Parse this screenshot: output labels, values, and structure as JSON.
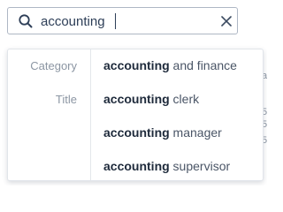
{
  "search": {
    "value": "accounting",
    "search_icon": "search-icon",
    "clear_icon": "close-icon"
  },
  "background": {
    "right_fragments": [
      "a",
      "5,",
      "5,",
      "5,"
    ]
  },
  "dropdown": {
    "groups": [
      {
        "label": "Category",
        "items": [
          {
            "match": "accounting",
            "rest": " and finance"
          }
        ]
      },
      {
        "label": "Title",
        "items": [
          {
            "match": "accounting",
            "rest": " clerk"
          },
          {
            "match": "accounting",
            "rest": " manager"
          },
          {
            "match": "accounting",
            "rest": " supervisor"
          }
        ]
      }
    ]
  },
  "colors": {
    "text_dark": "#2d3e57",
    "label_gray": "#8c96a3",
    "border": "#aeb7c4"
  }
}
